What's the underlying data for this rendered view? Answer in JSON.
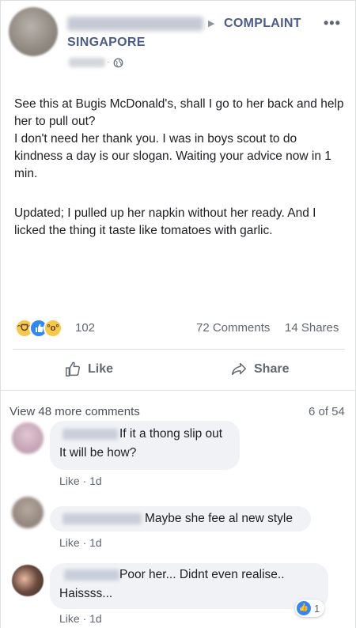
{
  "post": {
    "group_arrow": "▶",
    "group_name_line1": "COMPLAINT",
    "group_name_line2": "SINGAPORE",
    "more_label": "•••",
    "time_separator": "·",
    "paragraph_1": "See this at Bugis McDonald's, shall I go to her back and help her to pull out?\nI don't need her thank you. I was in boys scout to do kindness a day is our slogan. Waiting your advice now in 1 min.",
    "paragraph_2": "Updated; I pulled up her napkin without her ready. And I licked the thing it taste like tomatoes with garlic.",
    "reaction_icons": [
      "haha-icon",
      "like-icon",
      "wow-icon"
    ],
    "reaction_count": "102",
    "comments_count": "72 Comments",
    "shares_count": "14 Shares",
    "like_button": "Like",
    "share_button": "Share"
  },
  "comments_section": {
    "view_more": "View 48 more comments",
    "page_count": "6 of 54",
    "comments": [
      {
        "text_line1": "If it a thong slip out",
        "text_line2": "It will be how?",
        "meta": "Like · 1d"
      },
      {
        "text_line1": "Maybe she fee al new style",
        "meta": "Like · 1d"
      },
      {
        "text_line1": "Poor her... Didnt even realise..",
        "text_line2": "Haissss...",
        "meta": "Like · 1d",
        "reaction_count": "1"
      }
    ]
  },
  "colors": {
    "group_link": "#4a5d8a",
    "like_blue": "#2d88ff",
    "bubble_bg": "#f0f2f5",
    "meta_text": "#606770"
  }
}
